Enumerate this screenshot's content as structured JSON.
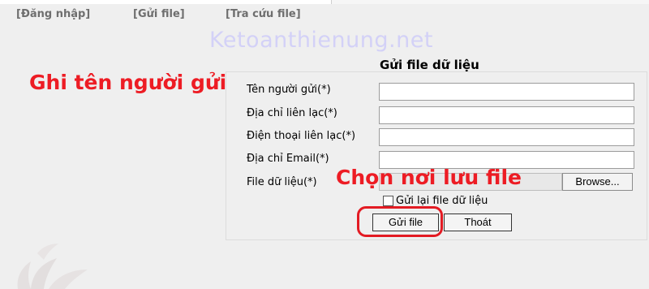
{
  "nav": {
    "login": "[Đăng nhập]",
    "send_file": "[Gửi file]",
    "lookup_file": "[Tra cứu file]"
  },
  "watermark": "Ketoanthienung.net",
  "annotations": {
    "sender_name_hint": "Ghi tên người gửi",
    "choose_location_hint": "Chọn nơi lưu file"
  },
  "form": {
    "title": "Gửi file dữ liệu",
    "fields": [
      {
        "label": "Tên người gửi(*)",
        "value": ""
      },
      {
        "label": "Địa chỉ liên lạc(*)",
        "value": ""
      },
      {
        "label": "Điện thoại liên lạc(*)",
        "value": ""
      },
      {
        "label": "Địa chỉ Email(*)",
        "value": ""
      }
    ],
    "file_label": "File dữ liệu(*)",
    "browse_label": "Browse...",
    "resend_label": "Gửi lại file dữ liệu",
    "resend_checked": false,
    "send_button": "Gửi file",
    "exit_button": "Thoát"
  },
  "colors": {
    "annotation": "#ed1c24",
    "watermark": "#d3d1f7",
    "background": "#efefef"
  }
}
